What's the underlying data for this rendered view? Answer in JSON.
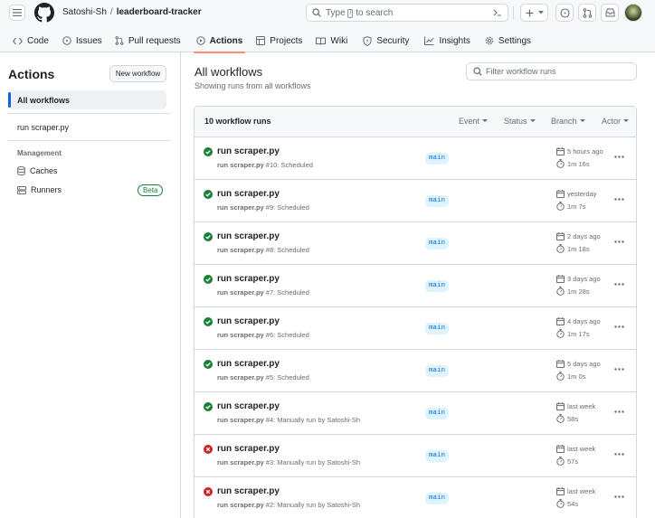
{
  "header": {
    "owner": "Satoshi-Sh",
    "separator": "/",
    "repo": "leaderboard-tracker",
    "search_pre": "Type",
    "search_key": "/",
    "search_post": "to search"
  },
  "tabs": [
    {
      "label": "Code",
      "icon": "code-icon"
    },
    {
      "label": "Issues",
      "icon": "issue-icon"
    },
    {
      "label": "Pull requests",
      "icon": "pull-request-icon"
    },
    {
      "label": "Actions",
      "icon": "play-icon"
    },
    {
      "label": "Projects",
      "icon": "table-icon"
    },
    {
      "label": "Wiki",
      "icon": "book-icon"
    },
    {
      "label": "Security",
      "icon": "shield-icon"
    },
    {
      "label": "Insights",
      "icon": "graph-icon"
    },
    {
      "label": "Settings",
      "icon": "gear-icon"
    }
  ],
  "sidebar": {
    "title": "Actions",
    "new_workflow": "New workflow",
    "all_workflows": "All workflows",
    "workflow": "run scraper.py",
    "management_heading": "Management",
    "caches": "Caches",
    "runners": "Runners",
    "runners_badge": "Beta"
  },
  "main": {
    "title": "All workflows",
    "subtitle": "Showing runs from all workflows",
    "filter_placeholder": "Filter workflow runs",
    "count": "10 workflow runs",
    "filters": [
      "Event",
      "Status",
      "Branch",
      "Actor"
    ]
  },
  "runs": [
    {
      "title": "run scraper.py",
      "name": "run scraper.py",
      "detail": "#10: Scheduled",
      "branch": "main",
      "when": "5 hours ago",
      "duration": "1m 16s",
      "status": "success"
    },
    {
      "title": "run scraper.py",
      "name": "run scraper.py",
      "detail": "#9: Scheduled",
      "branch": "main",
      "when": "yesterday",
      "duration": "1m 7s",
      "status": "success"
    },
    {
      "title": "run scraper.py",
      "name": "run scraper.py",
      "detail": "#8: Scheduled",
      "branch": "main",
      "when": "2 days ago",
      "duration": "1m 18s",
      "status": "success"
    },
    {
      "title": "run scraper.py",
      "name": "run scraper.py",
      "detail": "#7: Scheduled",
      "branch": "main",
      "when": "3 days ago",
      "duration": "1m 28s",
      "status": "success"
    },
    {
      "title": "run scraper.py",
      "name": "run scraper.py",
      "detail": "#6: Scheduled",
      "branch": "main",
      "when": "4 days ago",
      "duration": "1m 17s",
      "status": "success"
    },
    {
      "title": "run scraper.py",
      "name": "run scraper.py",
      "detail": "#5: Scheduled",
      "branch": "main",
      "when": "5 days ago",
      "duration": "1m 0s",
      "status": "success"
    },
    {
      "title": "run scraper.py",
      "name": "run scraper.py",
      "detail": "#4: Manually run by Satoshi-Sh",
      "branch": "main",
      "when": "last week",
      "duration": "58s",
      "status": "success"
    },
    {
      "title": "run scraper.py",
      "name": "run scraper.py",
      "detail": "#3: Manually run by Satoshi-Sh",
      "branch": "main",
      "when": "last week",
      "duration": "57s",
      "status": "failure"
    },
    {
      "title": "run scraper.py",
      "name": "run scraper.py",
      "detail": "#2: Manually run by Satoshi-Sh",
      "branch": "main",
      "when": "last week",
      "duration": "54s",
      "status": "failure"
    }
  ],
  "colors": {
    "success": "#1a7f37",
    "failure": "#cf222e",
    "accent": "#0969da",
    "tab_underline": "#fd8c73"
  }
}
